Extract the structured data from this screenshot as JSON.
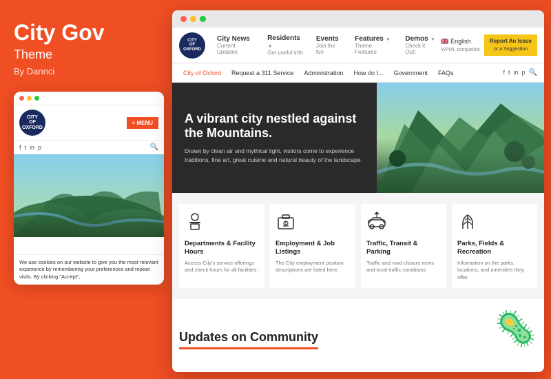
{
  "theme": {
    "title": "City Gov",
    "subtitle": "Theme",
    "author": "By Dannci"
  },
  "mobile": {
    "menu_btn": "≡ MENU",
    "social_icons": [
      "f",
      "t",
      "in",
      "p"
    ],
    "cookie_text": "We use cookies on our website to give you the most relevant experience by remembering your preferences and repeat visits. By clicking \"Accept\","
  },
  "browser": {
    "nav": {
      "items": [
        {
          "label": "City News",
          "sub": "Current Updates"
        },
        {
          "label": "Residents",
          "sub": "Get useful info",
          "has_arrow": true
        },
        {
          "label": "Events",
          "sub": "Join the fun"
        },
        {
          "label": "Features",
          "sub": "Theme Features",
          "has_arrow": true
        },
        {
          "label": "Demos",
          "sub": "Check it Out!",
          "has_arrow": true
        }
      ],
      "lang": "🇬🇧 English\nWPML compatible",
      "report_btn_line1": "Report An Issue",
      "report_btn_line2": "or a Suggestion"
    },
    "secondary_nav": {
      "items": [
        "City of Oxford",
        "Request a 311 Service",
        "Administration",
        "How do I...",
        "Government",
        "FAQs"
      ],
      "social": [
        "f",
        "t",
        "in",
        "p"
      ],
      "has_search": true
    },
    "hero": {
      "title": "A vibrant city nestled against the Mountains.",
      "text": "Drawn by clean air and mythical light, visitors come to experience traditions, fine art, great cuisine and natural beauty of the landscape."
    },
    "services": [
      {
        "icon": "👤",
        "title": "Departments & Facility Hours",
        "desc": "Access City's service offerings and check hours for all facilities."
      },
      {
        "icon": "💼",
        "title": "Employment & Job Listings",
        "desc": "The City employment position descriptions are listed here."
      },
      {
        "icon": "🚌",
        "title": "Traffic, Transit & Parking",
        "desc": "Traffic and road closure news and local traffic conditions"
      },
      {
        "icon": "🌿",
        "title": "Parks, Fields & Recreation",
        "desc": "Information on the parks, locations, and amenities they offer."
      }
    ],
    "bottom": {
      "title": "Updates on Community"
    }
  }
}
